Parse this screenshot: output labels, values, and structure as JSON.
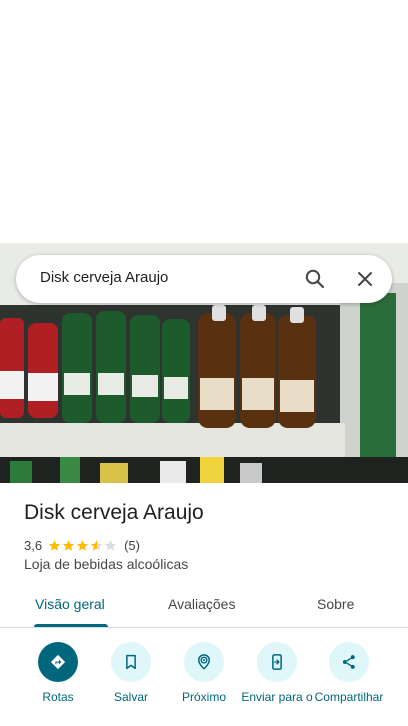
{
  "search": {
    "query": "Disk cerveja Araujo"
  },
  "place": {
    "name": "Disk cerveja Araujo",
    "rating": "3,6",
    "rating_stars": 3.6,
    "reviews_count": "(5)",
    "category": "Loja de bebidas alcoólicas"
  },
  "tabs": [
    {
      "label": "Visão geral",
      "active": true
    },
    {
      "label": "Avaliações",
      "active": false
    },
    {
      "label": "Sobre",
      "active": false
    }
  ],
  "actions": [
    {
      "label": "Rotas",
      "icon": "directions-icon"
    },
    {
      "label": "Salvar",
      "icon": "bookmark-icon"
    },
    {
      "label": "Próximo",
      "icon": "nearby-icon"
    },
    {
      "label": "Enviar para o",
      "icon": "send-to-phone-icon"
    },
    {
      "label": "Compartilhar",
      "icon": "share-icon"
    }
  ],
  "colors": {
    "accent": "#00677d",
    "accent_light": "#dff6fb",
    "star": "#fbbc04",
    "star_empty": "#dadce0"
  }
}
